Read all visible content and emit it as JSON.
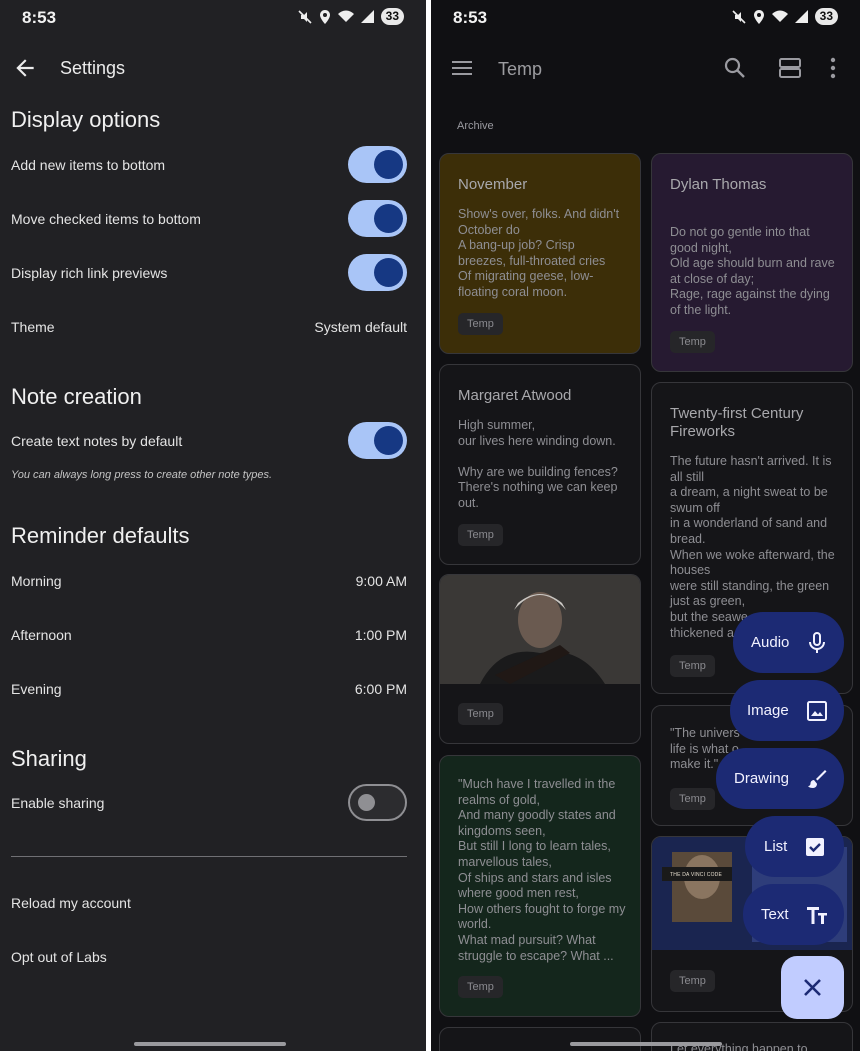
{
  "left": {
    "status": {
      "time": "8:53",
      "battery": "33"
    },
    "appbar": {
      "title": "Settings"
    },
    "display": {
      "title": "Display options",
      "add_new_items": {
        "label": "Add new items to bottom",
        "on": true
      },
      "move_checked": {
        "label": "Move checked items to bottom",
        "on": true
      },
      "rich_links": {
        "label": "Display rich link previews",
        "on": true
      },
      "theme": {
        "label": "Theme",
        "value": "System default"
      }
    },
    "note_creation": {
      "title": "Note creation",
      "text_default": {
        "label": "Create text notes by default",
        "on": true
      },
      "hint": "You can always long press to create other note types."
    },
    "reminders": {
      "title": "Reminder defaults",
      "morning": {
        "label": "Morning",
        "value": "9:00 AM"
      },
      "afternoon": {
        "label": "Afternoon",
        "value": "1:00 PM"
      },
      "evening": {
        "label": "Evening",
        "value": "6:00 PM"
      }
    },
    "sharing": {
      "title": "Sharing",
      "enable": {
        "label": "Enable sharing",
        "on": false
      }
    },
    "reload": "Reload my account",
    "opt_out": "Opt out of Labs"
  },
  "right": {
    "status": {
      "time": "8:53",
      "battery": "33"
    },
    "appbar": {
      "title": "Temp"
    },
    "section_label": "Archive",
    "notes": {
      "november": {
        "title": "November",
        "body": "Show's over, folks. And didn't October do\nA bang-up job? Crisp breezes, full-throated cries\nOf migrating geese, low-floating coral moon.",
        "label": "Temp",
        "color": "#3c2e08"
      },
      "dylan": {
        "title": "Dylan Thomas",
        "body": "Do not go gentle into that good night,\nOld age should burn and rave at close of day;\nRage, rage against the dying of the light.",
        "label": "Temp",
        "color": "#261a31"
      },
      "margaret": {
        "title": "Margaret Atwood",
        "body": "High summer,\nour lives here winding down.\n\nWhy are we building fences? There's nothing we can keep out.",
        "label": "Temp"
      },
      "fireworks": {
        "title": "Twenty-first Century Fireworks",
        "body": "The future hasn't arrived. It is all still\na dream, a night sweat to be swum off\nin a wonderland of sand and bread.\nWhen we woke afterward, the houses\nwere still standing, the green just as green,\nbut the seawe\nthickened a",
        "label": "Temp"
      },
      "photo": {
        "label": "Temp"
      },
      "universe": {
        "body": "\"The univers\nlife is what o\nmake it.\"",
        "label": "Temp"
      },
      "gold": {
        "body": "\"Much have I travelled in the realms of gold,\nAnd many goodly states and kingdoms seen,\nBut still I long to learn tales, marvellous tales,\nOf ships and stars and isles where good men rest,\nHow others fought to forge my world.\nWhat mad pursuit? What struggle to escape? What ...",
        "label": "Temp",
        "color": "#14261c"
      },
      "davinci": {
        "caption": "THE DA VINCI CODE",
        "label": "Temp"
      },
      "bottom_peek": "Let everything happen to"
    },
    "fab_menu": {
      "audio": "Audio",
      "image": "Image",
      "drawing": "Drawing",
      "list": "List",
      "text": "Text"
    }
  },
  "colors": {
    "settings_bg": "#212124",
    "keep_bg": "#101013",
    "toggle_on_track": "#a9c5f7",
    "toggle_on_knob": "#163883",
    "fab_bg": "#1c2a74",
    "fab_close_bg": "#c1ccff"
  }
}
